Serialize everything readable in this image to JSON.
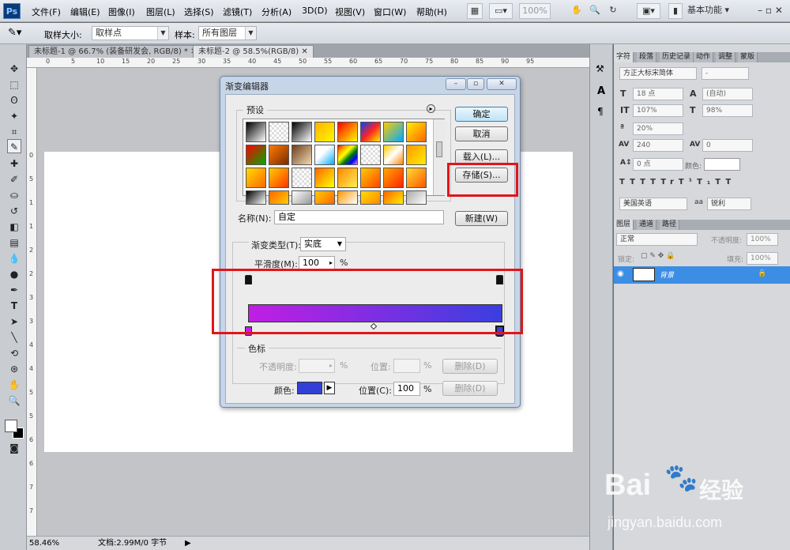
{
  "app": {
    "logo": "Ps"
  },
  "menu": [
    "文件(F)",
    "编辑(E)",
    "图像(I)",
    "图层(L)",
    "选择(S)",
    "滤镜(T)",
    "分析(A)",
    "3D(D)",
    "视图(V)",
    "窗口(W)",
    "帮助(H)"
  ],
  "menubar_right": {
    "zoom": "100%",
    "workspace": "基本功能"
  },
  "options": {
    "sample_size_label": "取样大小:",
    "sample_size_value": "取样点",
    "sample_label": "样本:",
    "sample_value": "所有图层"
  },
  "doc_tabs": [
    {
      "label": "未标题-1 @ 66.7% (装备研发会, RGB/8) *"
    },
    {
      "label": "未标题-2 @ 58.5%(RGB/8)"
    }
  ],
  "rulers": {
    "h": [
      "0",
      "5",
      "10",
      "15",
      "20",
      "25",
      "30",
      "35",
      "40",
      "45",
      "50",
      "55",
      "60",
      "65",
      "70",
      "75",
      "80",
      "85",
      "90",
      "95"
    ],
    "v": [
      "0",
      "5",
      "1",
      "1",
      "2",
      "2",
      "3",
      "3",
      "4",
      "4",
      "5",
      "5",
      "6",
      "6",
      "7",
      "7"
    ]
  },
  "status": {
    "zoom": "58.46%",
    "doc": "文档:2.99M/0 字节"
  },
  "dialog": {
    "title": "渐变编辑器",
    "presets_label": "预设",
    "ok": "确定",
    "cancel": "取消",
    "load": "载入(L)...",
    "save": "存储(S)...",
    "name_label": "名称(N):",
    "name_value": "自定",
    "new_button": "新建(W)",
    "type_label": "渐变类型(T):",
    "type_value": "实底",
    "smooth_label": "平滑度(M):",
    "smooth_value": "100",
    "smooth_unit": "%",
    "stops_label": "色标",
    "opacity_label": "不透明度:",
    "opacity_unit": "%",
    "position_label": "位置:",
    "position_unit": "%",
    "delete1": "删除(D)",
    "color_label": "颜色:",
    "position_c_label": "位置(C):",
    "position_c_value": "100",
    "position_c_unit": "%",
    "delete2": "删除(D)",
    "gradient": {
      "start": "#c11ee3",
      "end": "#3a3fe0"
    },
    "swatch_color": "#3340d8"
  },
  "char_panel": {
    "tabs": [
      "字符",
      "段落",
      "历史记录",
      "动作",
      "调整",
      "蒙版"
    ],
    "font": "方正大标宋简体",
    "style": "-",
    "size": "18 点",
    "leading": "(自动)",
    "vscale": "107%",
    "hscale": "98%",
    "baseline_pct": "20%",
    "tracking": "240",
    "kerning": "0",
    "shift": "0 点",
    "color_label": "颜色:",
    "language": "美国英语",
    "aa_label": "aa",
    "aa": "锐利",
    "glyphs": [
      "T",
      "T",
      "TT",
      "Tr",
      "T¹",
      "T₁",
      "T",
      "T"
    ]
  },
  "layers_panel": {
    "tabs": [
      "图层",
      "通道",
      "路径"
    ],
    "mode": "正常",
    "opacity_label": "不透明度:",
    "opacity": "100%",
    "lock_label": "锁定:",
    "fill_label": "填充:",
    "fill": "100%",
    "layer_name": "背景"
  },
  "watermark": {
    "brand": "Bai",
    "brand2": "经验",
    "url": "jingyan.baidu.com"
  }
}
